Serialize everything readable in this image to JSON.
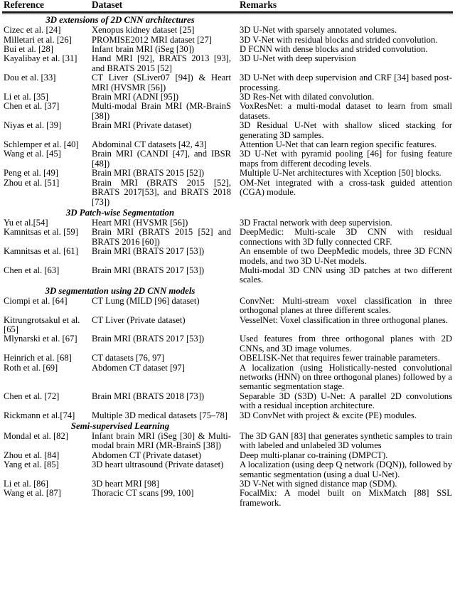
{
  "table": {
    "columns": [
      {
        "key": "reference",
        "label": "Reference"
      },
      {
        "key": "dataset",
        "label": "Dataset"
      },
      {
        "key": "remarks",
        "label": "Remarks"
      }
    ],
    "sections": [
      {
        "heading": "3D extensions of 2D CNN architectures",
        "rows": [
          {
            "reference": "Cizec et al. [24]",
            "dataset": "Xenopus kidney dataset [25]",
            "remarks": "3D U-Net with sparsely annotated volumes."
          },
          {
            "reference": "Milletari et al. [26]",
            "dataset": "PROMISE2012 MRI dataset [27]",
            "remarks": "3D V-Net with residual blocks and strided convolution."
          },
          {
            "reference": "Bui et al. [28]",
            "dataset": "Infant brain MRI (iSeg [30])",
            "remarks": "D FCNN with dense blocks and strided convolution."
          },
          {
            "reference": "Kayalibay et al. [31]",
            "dataset": "Hand MRI [92], BRATS 2013 [93], and BRATS 2015 [52]",
            "remarks": "3D U-Net with deep supervision"
          },
          {
            "reference": "Dou et al. [33]",
            "dataset": "CT Liver (SLiver07 [94]) & Heart MRI (HVSMR [56])",
            "remarks": "3D U-Net with deep supervision and CRF [34] based post-processing."
          },
          {
            "reference": "Li et al. [35]",
            "dataset": "Brain MRI (ADNI [95])",
            "remarks": "3D Res-Net with dilated convolution."
          },
          {
            "reference": "Chen et al. [37]",
            "dataset": "Multi-modal Brain MRI (MR-BrainS [38])",
            "remarks": "VoxResNet: a multi-modal dataset to learn from small datasets."
          },
          {
            "reference": "Niyas et al. [39]",
            "dataset": "Brain MRI (Private dataset)",
            "remarks": "3D Residual U-Net with shallow sliced stacking for generating 3D samples."
          },
          {
            "reference": "Schlemper et al. [40]",
            "dataset": "Abdominal CT datasets [42, 43]",
            "remarks": "Attention U-Net that can learn region specific features."
          },
          {
            "reference": "Wang et al. [45]",
            "dataset": "Brain MRI (CANDI [47], and IBSR [48])",
            "remarks": "3D U-Net with pyramid pooling [46] for fusing feature maps from different decoding levels."
          },
          {
            "reference": "Peng et al. [49]",
            "dataset": "Brain MRI (BRATS 2015 [52])",
            "remarks": "Multiple U-Net architectures with Xception [50] blocks."
          },
          {
            "reference": "Zhou et al. [51]",
            "dataset": "Brain MRI (BRATS 2015 [52], BRATS 2017[53], and BRATS 2018 [73])",
            "remarks": "OM-Net integrated with a cross-task guided attention (CGA) module."
          }
        ]
      },
      {
        "heading": "3D Patch-wise Segmentation",
        "rows": [
          {
            "reference": "Yu et al.[54]",
            "dataset": "Heart MRI (HVSMR [56])",
            "remarks": "3D Fractal network with deep supervision."
          },
          {
            "reference": "Kamnitsas et al. [59]",
            "dataset": "Brain MRI (BRATS 2015 [52] and BRATS 2016 [60])",
            "remarks": "DeepMedic: Multi-scale 3D CNN with residual connections with 3D fully connected CRF."
          },
          {
            "reference": "Kamnitsas et al. [61]",
            "dataset": "Brain MRI (BRATS 2017 [53])",
            "remarks": "An ensemble of two DeepMedic models, three 3D FCNN models, and two 3D U-Net models."
          },
          {
            "reference": "Chen et al. [63]",
            "dataset": "Brain MRI (BRATS 2017 [53])",
            "remarks": "Multi-modal 3D CNN using 3D patches at two different scales."
          }
        ]
      },
      {
        "heading": "3D segmentation using 2D CNN models",
        "rows": [
          {
            "reference": "Ciompi et al. [64]",
            "dataset": "CT Lung (MILD [96] dataset)",
            "remarks": "ConvNet: Multi-stream voxel classification in three orthogonal planes at three different scales."
          },
          {
            "reference": "Kitrungrotsakul et al. [65]",
            "dataset": "CT Liver (Private dataset)",
            "remarks": "VesselNet: Voxel classification in three orthogonal planes."
          },
          {
            "reference": "Mlynarski et al. [67]",
            "dataset": "Brain MRI (BRATS 2017 [53])",
            "remarks": "Used features from three orthogonal planes with 2D CNNs, and 3D image volumes."
          },
          {
            "reference": "Heinrich et al. [68]",
            "dataset": "CT datasets [76, 97]",
            "remarks": "OBELISK-Net that requires fewer trainable parameters."
          },
          {
            "reference": "Roth et al. [69]",
            "dataset": "Abdomen CT dataset [97]",
            "remarks": "A localization (using Holistically-nested convolutional networks (HNN) on three orthogonal planes) followed by a semantic segmentation stage."
          },
          {
            "reference": "Chen et al. [72]",
            "dataset": "Brain MRI (BRATS 2018 [73])",
            "remarks": "Separable 3D (S3D) U-Net: A parallel 2D convolutions with a residual inception architecture."
          },
          {
            "reference": "Rickmann et al.[74]",
            "dataset": "Multiple 3D medical datasets [75–78]",
            "remarks": "3D ConvNet with project & excite (PE) modules."
          }
        ]
      },
      {
        "heading": "Semi-supervised Learning",
        "rows": [
          {
            "reference": "Mondal et al. [82]",
            "dataset": "Infant brain MRI (iSeg [30] & Multi-modal brain MRI (MR-BrainS [38])",
            "remarks": "The 3D GAN [83] that generates synthetic samples to train with labeled and unlabeled 3D volumes"
          },
          {
            "reference": "Zhou et al. [84]",
            "dataset": "Abdomen CT (Private dataset)",
            "remarks": "Deep multi-planar co-training (DMPCT)."
          },
          {
            "reference": "Yang et al. [85]",
            "dataset": "3D heart ultrasound (Private dataset)",
            "remarks": "A localization (using deep Q network (DQN)), followed by semantic segmentation (using a dual U-Net)."
          },
          {
            "reference": "Li et al. [86]",
            "dataset": "3D heart MRI [98]",
            "remarks": "3D V-Net with signed distance map (SDM)."
          },
          {
            "reference": "Wang et al. [87]",
            "dataset": "Thoracic CT scans [99, 100]",
            "remarks": "FocalMix: A model built on MixMatch [88] SSL framework."
          }
        ]
      }
    ]
  }
}
